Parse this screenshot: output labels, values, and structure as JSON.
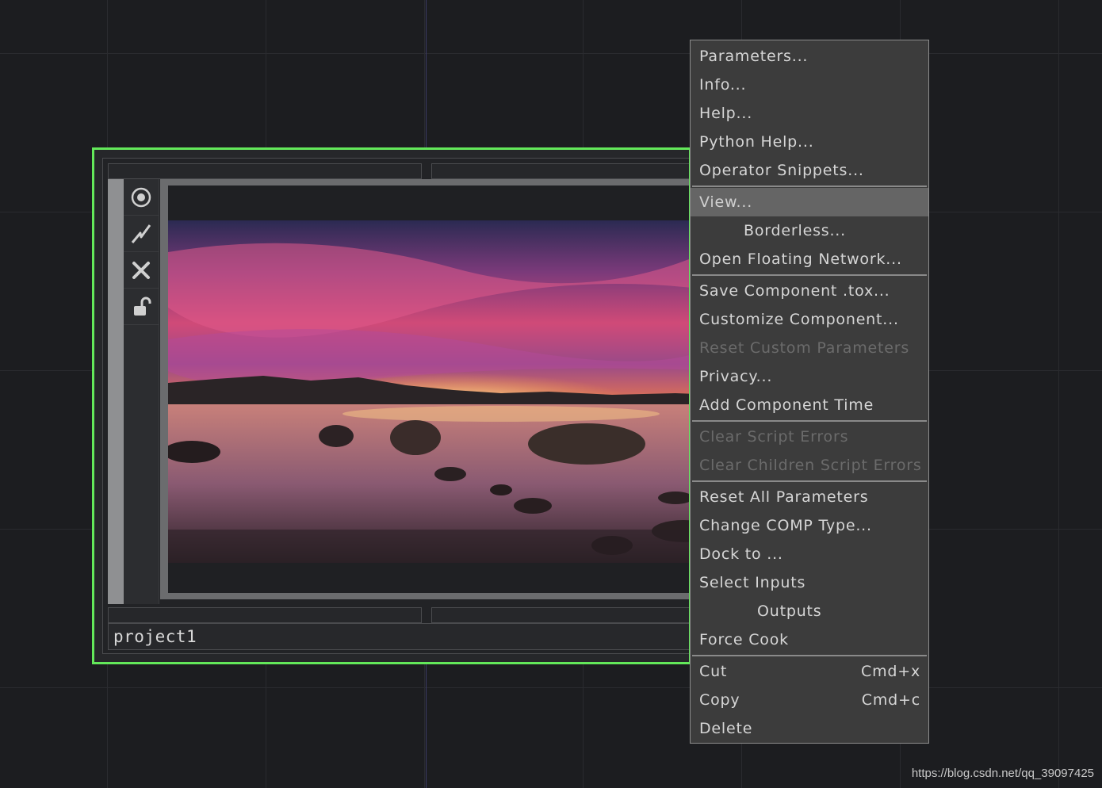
{
  "node": {
    "name": "project1",
    "toolbar_icons": [
      "viewer-toggle-icon",
      "cook-icon",
      "bypass-icon",
      "lock-icon"
    ],
    "border_color": "#63e85a"
  },
  "menu": {
    "groups": [
      [
        {
          "label": "Parameters..."
        },
        {
          "label": "Info..."
        },
        {
          "label": "Help..."
        },
        {
          "label": "Python Help..."
        },
        {
          "label": "Operator Snippets..."
        }
      ],
      [
        {
          "label": "View...",
          "highlighted": true
        },
        {
          "label": "Borderless...",
          "indent": 1
        },
        {
          "label": "Open Floating Network..."
        }
      ],
      [
        {
          "label": "Save Component .tox..."
        },
        {
          "label": "Customize Component..."
        },
        {
          "label": "Reset Custom Parameters",
          "disabled": true
        },
        {
          "label": "Privacy..."
        },
        {
          "label": "Add Component Time"
        }
      ],
      [
        {
          "label": "Clear Script Errors",
          "disabled": true
        },
        {
          "label": "Clear Children Script Errors",
          "disabled": true
        }
      ],
      [
        {
          "label": "Reset All Parameters"
        },
        {
          "label": "Change COMP Type..."
        },
        {
          "label": "Dock to ..."
        },
        {
          "label": "Select Inputs"
        },
        {
          "label": "Outputs",
          "indent": 2
        },
        {
          "label": "Force Cook"
        }
      ],
      [
        {
          "label": "Cut",
          "shortcut": "Cmd+x"
        },
        {
          "label": "Copy",
          "shortcut": "Cmd+c"
        },
        {
          "label": "Delete"
        }
      ]
    ]
  },
  "watermark": "https://blog.csdn.net/qq_39097425"
}
